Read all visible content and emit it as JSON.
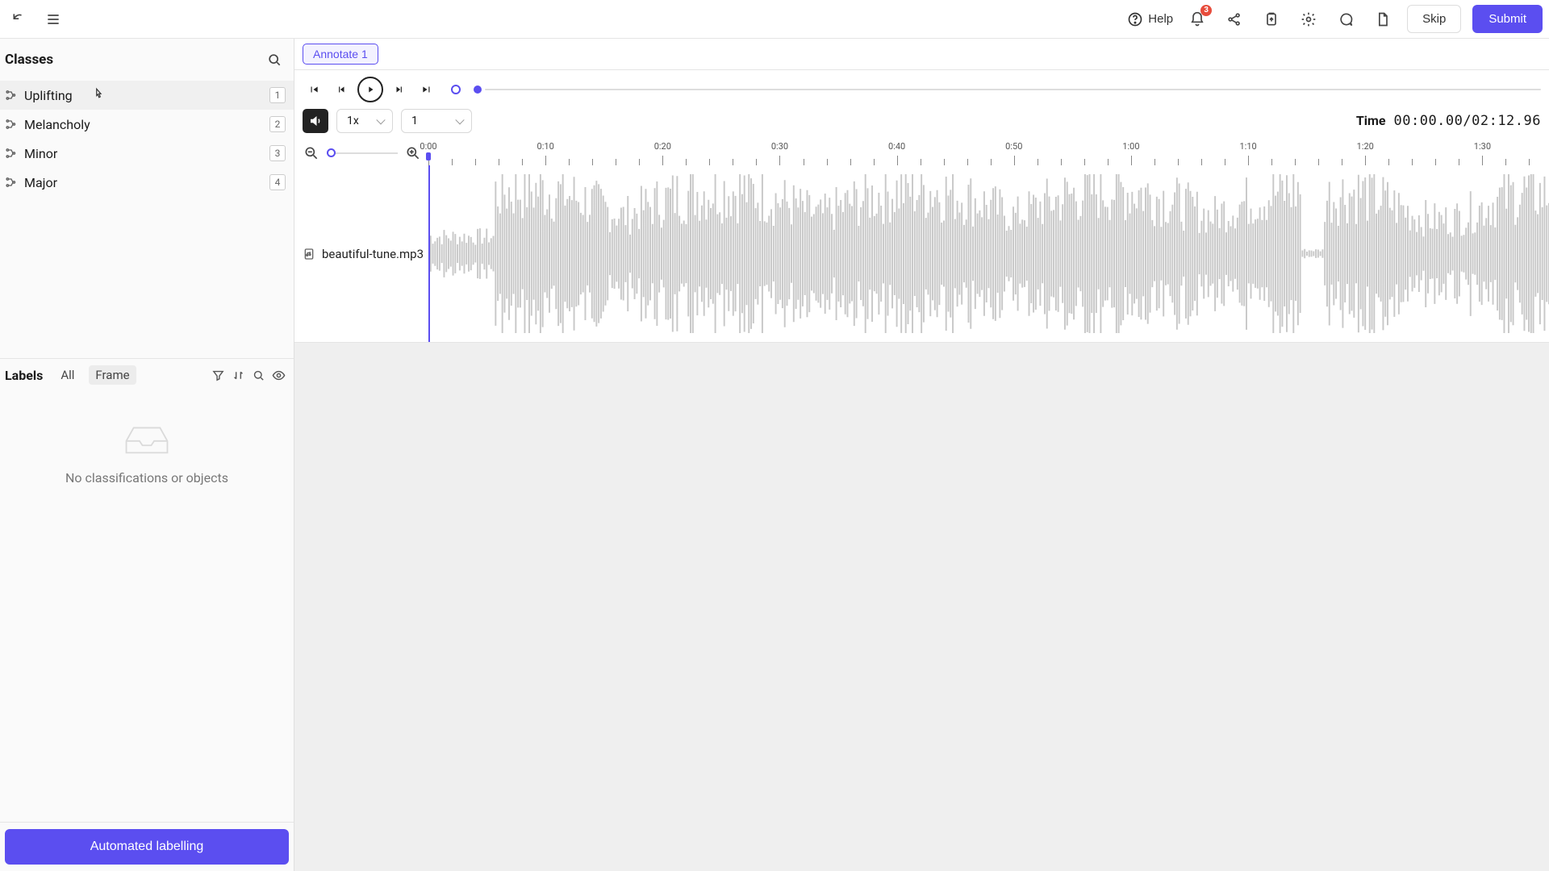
{
  "topbar": {
    "help_label": "Help",
    "notification_count": "3",
    "skip_label": "Skip",
    "submit_label": "Submit"
  },
  "sidebar": {
    "classes_title": "Classes",
    "classes": [
      {
        "name": "Uplifting",
        "key": "1"
      },
      {
        "name": "Melancholy",
        "key": "2"
      },
      {
        "name": "Minor",
        "key": "3"
      },
      {
        "name": "Major",
        "key": "4"
      }
    ],
    "labels_title": "Labels",
    "tabs": {
      "all": "All",
      "frame": "Frame"
    },
    "empty_text": "No classifications or objects",
    "auto_label_button": "Automated labelling"
  },
  "main": {
    "annotate_tab": "Annotate 1",
    "speed_value": "1x",
    "channel_value": "1",
    "time_label": "Time",
    "time_value": "00:00.00/02:12.96",
    "track_filename": "beautiful-tune.mp3",
    "timeline_labels": [
      "0:00",
      "0:10",
      "0:20",
      "0:30",
      "0:40",
      "0:50",
      "1:00",
      "1:10",
      "1:20",
      "1:30"
    ]
  }
}
